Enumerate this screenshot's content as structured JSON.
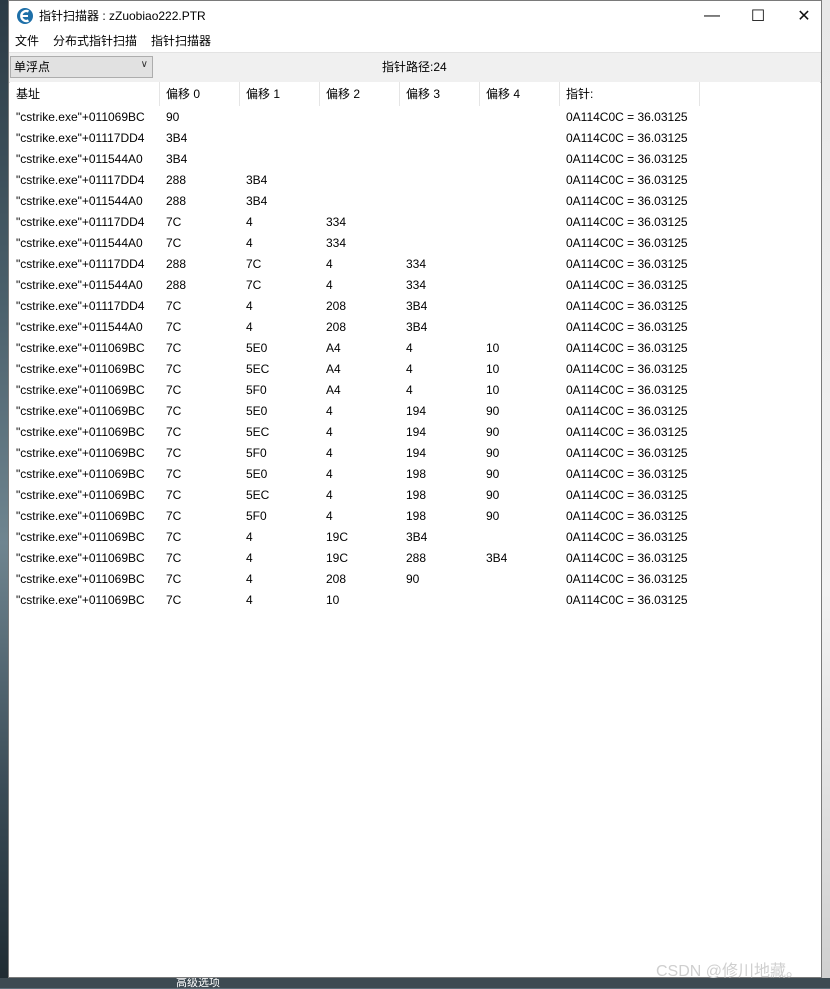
{
  "window": {
    "title": "指针扫描器 : zZuobiao222.PTR",
    "minimize_glyph": "—",
    "maximize_glyph": "☐",
    "close_glyph": "✕"
  },
  "menu": [
    "文件",
    "分布式指针扫描",
    "指针扫描器"
  ],
  "toolbar": {
    "value_type": "单浮点",
    "path_count": "指针路径:24"
  },
  "table": {
    "columns": [
      "基址",
      "偏移 0",
      "偏移 1",
      "偏移 2",
      "偏移 3",
      "偏移 4",
      "指针:"
    ],
    "rows": [
      [
        "\"cstrike.exe\"+011069BC",
        "90",
        "",
        "",
        "",
        "",
        "0A114C0C = 36.03125"
      ],
      [
        "\"cstrike.exe\"+01117DD4",
        "3B4",
        "",
        "",
        "",
        "",
        "0A114C0C = 36.03125"
      ],
      [
        "\"cstrike.exe\"+011544A0",
        "3B4",
        "",
        "",
        "",
        "",
        "0A114C0C = 36.03125"
      ],
      [
        "\"cstrike.exe\"+01117DD4",
        "288",
        "3B4",
        "",
        "",
        "",
        "0A114C0C = 36.03125"
      ],
      [
        "\"cstrike.exe\"+011544A0",
        "288",
        "3B4",
        "",
        "",
        "",
        "0A114C0C = 36.03125"
      ],
      [
        "\"cstrike.exe\"+01117DD4",
        "7C",
        "4",
        "334",
        "",
        "",
        "0A114C0C = 36.03125"
      ],
      [
        "\"cstrike.exe\"+011544A0",
        "7C",
        "4",
        "334",
        "",
        "",
        "0A114C0C = 36.03125"
      ],
      [
        "\"cstrike.exe\"+01117DD4",
        "288",
        "7C",
        "4",
        "334",
        "",
        "0A114C0C = 36.03125"
      ],
      [
        "\"cstrike.exe\"+011544A0",
        "288",
        "7C",
        "4",
        "334",
        "",
        "0A114C0C = 36.03125"
      ],
      [
        "\"cstrike.exe\"+01117DD4",
        "7C",
        "4",
        "208",
        "3B4",
        "",
        "0A114C0C = 36.03125"
      ],
      [
        "\"cstrike.exe\"+011544A0",
        "7C",
        "4",
        "208",
        "3B4",
        "",
        "0A114C0C = 36.03125"
      ],
      [
        "\"cstrike.exe\"+011069BC",
        "7C",
        "5E0",
        "A4",
        "4",
        "10",
        "0A114C0C = 36.03125"
      ],
      [
        "\"cstrike.exe\"+011069BC",
        "7C",
        "5EC",
        "A4",
        "4",
        "10",
        "0A114C0C = 36.03125"
      ],
      [
        "\"cstrike.exe\"+011069BC",
        "7C",
        "5F0",
        "A4",
        "4",
        "10",
        "0A114C0C = 36.03125"
      ],
      [
        "\"cstrike.exe\"+011069BC",
        "7C",
        "5E0",
        "4",
        "194",
        "90",
        "0A114C0C = 36.03125"
      ],
      [
        "\"cstrike.exe\"+011069BC",
        "7C",
        "5EC",
        "4",
        "194",
        "90",
        "0A114C0C = 36.03125"
      ],
      [
        "\"cstrike.exe\"+011069BC",
        "7C",
        "5F0",
        "4",
        "194",
        "90",
        "0A114C0C = 36.03125"
      ],
      [
        "\"cstrike.exe\"+011069BC",
        "7C",
        "5E0",
        "4",
        "198",
        "90",
        "0A114C0C = 36.03125"
      ],
      [
        "\"cstrike.exe\"+011069BC",
        "7C",
        "5EC",
        "4",
        "198",
        "90",
        "0A114C0C = 36.03125"
      ],
      [
        "\"cstrike.exe\"+011069BC",
        "7C",
        "5F0",
        "4",
        "198",
        "90",
        "0A114C0C = 36.03125"
      ],
      [
        "\"cstrike.exe\"+011069BC",
        "7C",
        "4",
        "19C",
        "3B4",
        "",
        "0A114C0C = 36.03125"
      ],
      [
        "\"cstrike.exe\"+011069BC",
        "7C",
        "4",
        "19C",
        "288",
        "3B4",
        "0A114C0C = 36.03125"
      ],
      [
        "\"cstrike.exe\"+011069BC",
        "7C",
        "4",
        "208",
        "90",
        "",
        "0A114C0C = 36.03125"
      ],
      [
        "\"cstrike.exe\"+011069BC",
        "7C",
        "4",
        "10",
        "",
        "",
        "0A114C0C = 36.03125"
      ]
    ]
  },
  "watermark": "CSDN @修川地藏。",
  "background_text": "高级选项"
}
